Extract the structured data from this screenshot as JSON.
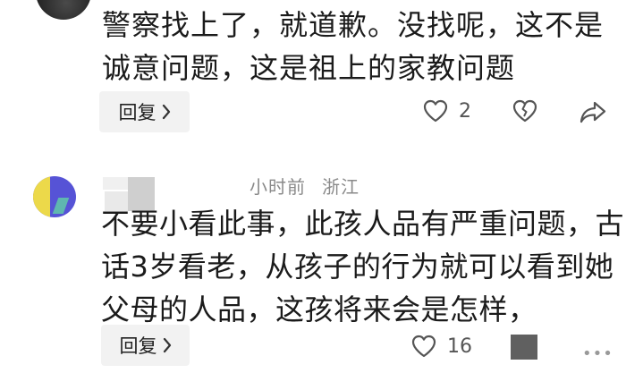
{
  "comments": [
    {
      "text": "警察找上了，就道歉。没找呢，这不是诚意问题，这是祖上的家教问题",
      "reply_label": "回复",
      "like_count": "2"
    },
    {
      "time": "小时前",
      "location": "浙江",
      "text": "不要小看此事，此孩人品有严重问题，古话3岁看老，从孩子的行为就可以看到她父母的人品，这孩将来会是怎样，",
      "reply_label": "回复",
      "like_count": "16"
    }
  ],
  "icons": {
    "chevron": "chevron-right-icon",
    "like": "heart-outline-icon",
    "dislike": "broken-heart-icon",
    "share": "share-arrow-icon",
    "more": "more-dots-icon"
  }
}
